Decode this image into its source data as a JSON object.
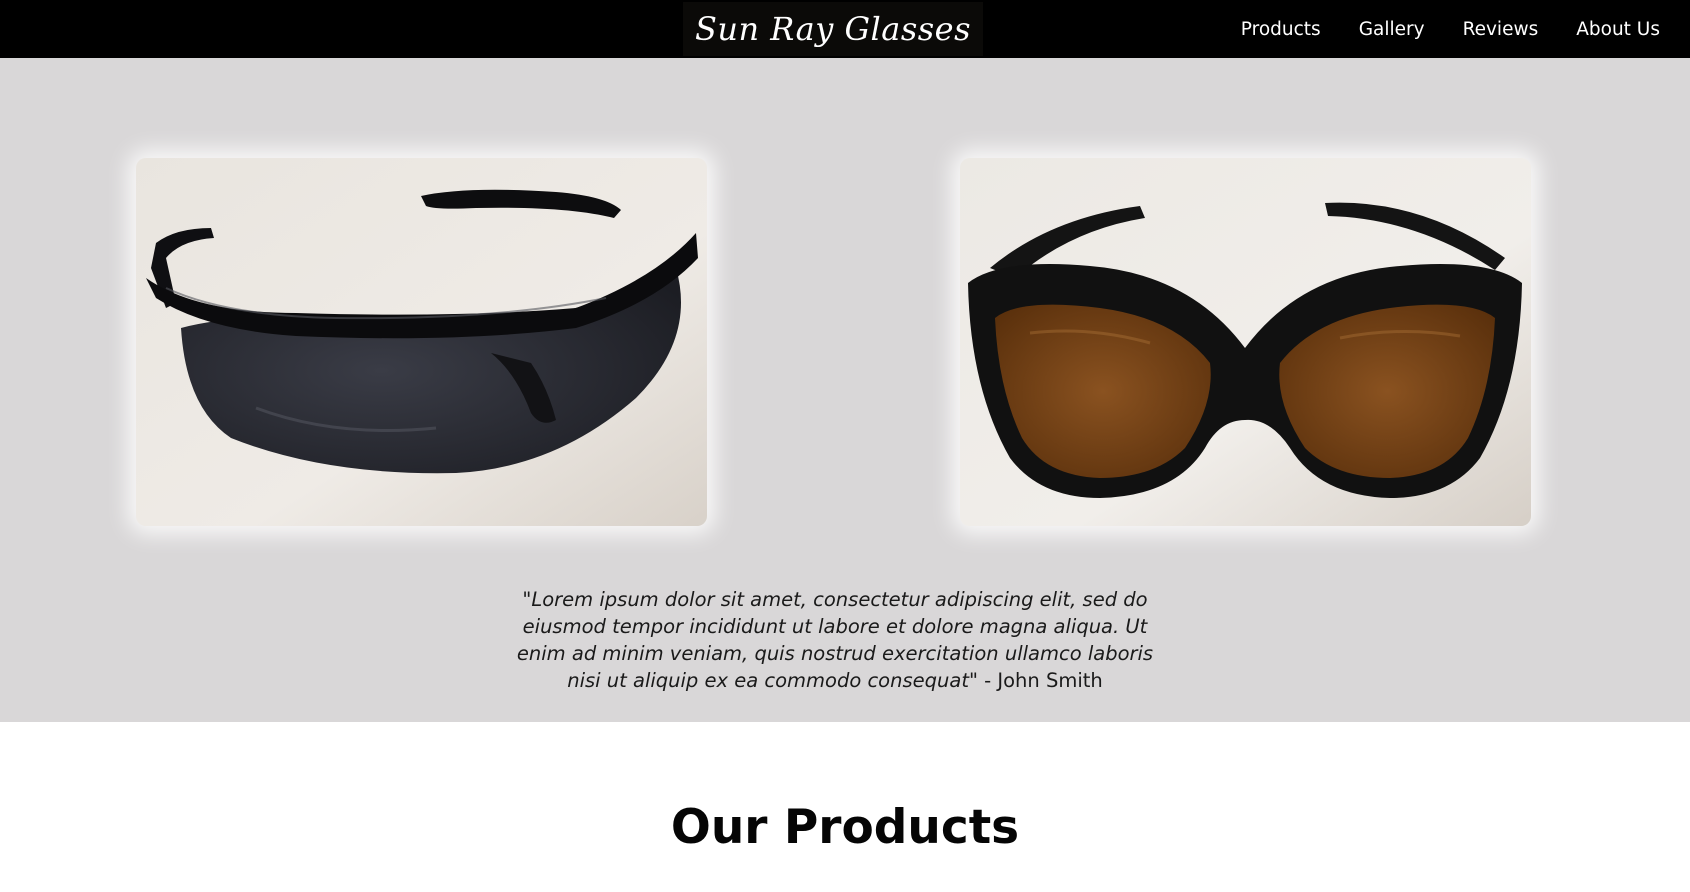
{
  "header": {
    "logo_text": "Sun Ray Glasses",
    "nav": [
      {
        "label": "Products"
      },
      {
        "label": "Gallery"
      },
      {
        "label": "Reviews"
      },
      {
        "label": "About Us"
      }
    ]
  },
  "hero": {
    "images": [
      {
        "name": "black-sport-sunglasses",
        "lens_color": "#2c2d35"
      },
      {
        "name": "brown-lens-sunglasses",
        "lens_color": "#7a4616"
      }
    ],
    "quote": "\"Lorem ipsum dolor sit amet, consectetur adipiscing elit, sed do eiusmod tempor incididunt ut labore et dolore magna aliqua. Ut enim ad minim veniam, quis nostrud exercitation ullamco laboris nisi ut aliquip ex ea commodo consequat\"",
    "quote_author": " - John Smith"
  },
  "products": {
    "title": "Our Products"
  },
  "colors": {
    "navbar": "#000000",
    "hero_bg": "#d9d7d8",
    "text": "#111111"
  }
}
